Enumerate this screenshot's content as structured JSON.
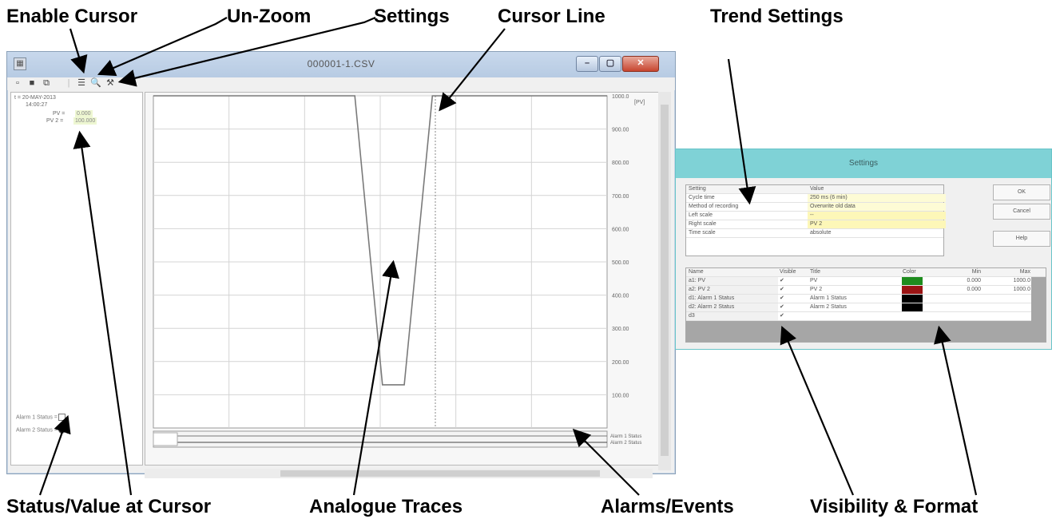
{
  "annotations": {
    "enable_cursor": "Enable Cursor",
    "un_zoom": "Un-Zoom",
    "settings": "Settings",
    "cursor_line": "Cursor Line",
    "trend_settings": "Trend Settings",
    "status_value": "Status/Value at Cursor",
    "analogue_traces": "Analogue Traces",
    "alarms_events": "Alarms/Events",
    "visibility_format": "Visibility & Format"
  },
  "window": {
    "title": "000001-1.CSV"
  },
  "left_panel": {
    "cursor_time_line1": "t = 20-MAY-2013",
    "cursor_time_line2": "14:00:27",
    "pv_label": "PV =",
    "pv_value": "0.000",
    "pv2_label": "PV 2 =",
    "pv2_value": "100.000",
    "alarm1": "Alarm 1 Status =",
    "alarm2": "Alarm 2 Status ="
  },
  "chart": {
    "y_ticks": [
      "1000.0",
      "900.00",
      "800.00",
      "700.00",
      "600.00",
      "500.00",
      "400.00",
      "300.00",
      "200.00",
      "100.00"
    ],
    "unit": "[PV]",
    "alarm_labels": [
      "Alarm 1 Status",
      "Alarm 2 Status"
    ]
  },
  "chart_data": {
    "type": "line",
    "title": "",
    "ylabel": "[PV]",
    "ylim": [
      100,
      1000
    ],
    "series": [
      {
        "name": "PV 2",
        "x": [
          0,
          0.444,
          0.505,
          0.553,
          0.615,
          1.0
        ],
        "y": [
          1000,
          1000,
          130,
          130,
          1000,
          1000
        ]
      }
    ]
  },
  "dialog": {
    "title": "Settings",
    "ok": "OK",
    "cancel": "Cancel",
    "help": "Help",
    "settings_header": [
      "Setting",
      "Value"
    ],
    "settings_rows": [
      [
        "Cycle time",
        "250 ms (6 min)"
      ],
      [
        "Method of recording",
        "Overwrite old data"
      ],
      [
        "Left scale",
        "--"
      ],
      [
        "Right scale",
        "PV 2"
      ],
      [
        "Time scale",
        "absolute"
      ]
    ],
    "channels_header": [
      "Name",
      "Visible",
      "Title",
      "Color",
      "Min",
      "Max"
    ],
    "channels": [
      {
        "name": "a1: PV",
        "visible": "✔",
        "title": "PV",
        "color": "#1e8c1e",
        "min": "0.000",
        "max": "1000.0"
      },
      {
        "name": "a2: PV 2",
        "visible": "✔",
        "title": "PV 2",
        "color": "#9a1414",
        "min": "0.000",
        "max": "1000.0"
      },
      {
        "name": "d1: Alarm 1 Status",
        "visible": "✔",
        "title": "Alarm 1 Status",
        "color": "#000000",
        "min": "",
        "max": ""
      },
      {
        "name": "d2: Alarm 2 Status",
        "visible": "✔",
        "title": "Alarm 2 Status",
        "color": "#000000",
        "min": "",
        "max": ""
      },
      {
        "name": "d3",
        "visible": "✔",
        "title": "",
        "color": "",
        "min": "",
        "max": ""
      }
    ]
  }
}
